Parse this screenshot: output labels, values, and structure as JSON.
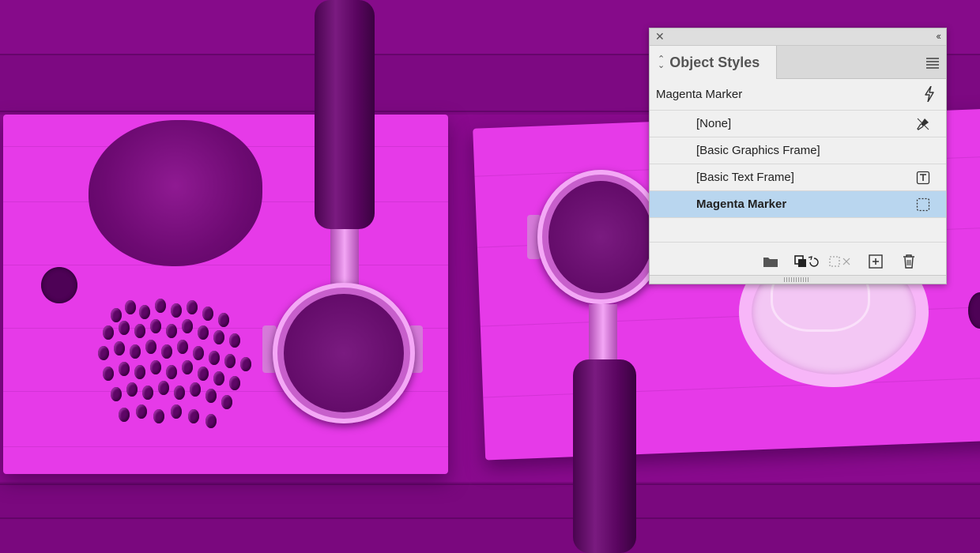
{
  "panel": {
    "title": "Object Styles",
    "default_style": "Magenta Marker",
    "styles": [
      {
        "label": "[None]",
        "icon": "clear-overrides-icon"
      },
      {
        "label": "[Basic Graphics Frame]",
        "icon": ""
      },
      {
        "label": "[Basic Text Frame]",
        "icon": "text-frame-icon"
      },
      {
        "label": "Magenta Marker",
        "icon": "graphic-frame-icon",
        "selected": true
      }
    ],
    "footer_icons": [
      "new-style-group-icon",
      "clear-overrides-icon",
      "clear-non-defined-attributes-icon",
      "new-style-icon",
      "delete-style-icon"
    ]
  },
  "colors": {
    "background_magenta": "#8a0a8e",
    "selection": "#b9d6ef",
    "panel": "#f0f0f0"
  }
}
